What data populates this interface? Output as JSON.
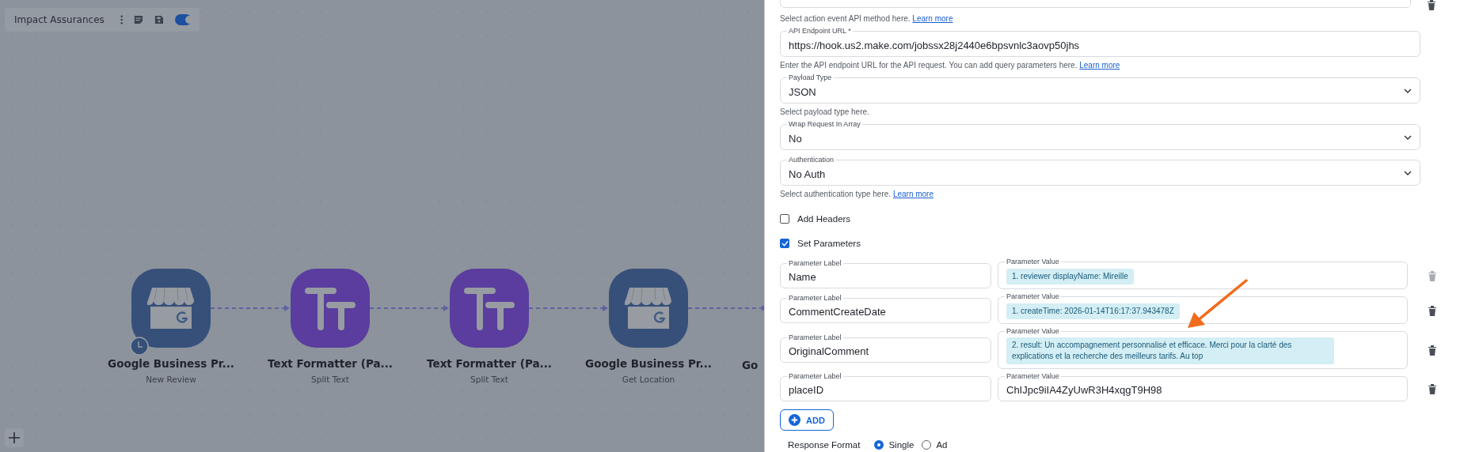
{
  "canvas": {
    "scenario_name": "Impact Assurances",
    "active": true,
    "nodes": [
      {
        "kind": "google",
        "title": "Google Business Pr...",
        "subtitle": "New Review",
        "trigger": true
      },
      {
        "kind": "text",
        "title": "Text Formatter (Pa...",
        "subtitle": "Split Text",
        "trigger": false
      },
      {
        "kind": "text",
        "title": "Text Formatter (Pa...",
        "subtitle": "Split Text",
        "trigger": false
      },
      {
        "kind": "google",
        "title": "Google Business Pr...",
        "subtitle": "Get Location",
        "trigger": false
      }
    ],
    "cut_node_title": "Go"
  },
  "panel": {
    "method_helper": {
      "text": "Select action event API method here.",
      "link": "Learn more"
    },
    "fields": [
      {
        "kind": "text",
        "label": "API Endpoint URL *",
        "value": "https://hook.us2.make.com/jobssx28j2440e6bpsvnlc3aovp50jhs",
        "helper": "Enter the API endpoint URL for the API request. You can add query parameters here.",
        "link": "Learn more"
      },
      {
        "kind": "select",
        "label": "Payload Type",
        "value": "JSON",
        "helper": "Select payload type here."
      },
      {
        "kind": "select",
        "label": "Wrap Request In Array",
        "value": "No"
      },
      {
        "kind": "select",
        "label": "Authentication",
        "value": "No Auth",
        "helper": "Select authentication type here.",
        "link": "Learn more"
      }
    ],
    "checkboxes": [
      {
        "label": "Add Headers",
        "checked": false
      },
      {
        "label": "Set Parameters",
        "checked": true
      }
    ],
    "parameters": [
      {
        "label_caption": "Parameter Label",
        "label": "Name",
        "value_caption": "Parameter Value",
        "value": "1. reviewer displayName: Mireille",
        "kind": "token",
        "disabled": true
      },
      {
        "label_caption": "Parameter Label",
        "label": "CommentCreateDate",
        "value_caption": "Parameter Value",
        "value": "1. createTime: 2026-01-14T16:17:37.943478Z",
        "kind": "token",
        "disabled": false
      },
      {
        "label_caption": "Parameter Label",
        "label": "OriginalComment",
        "value_caption": "Parameter Value",
        "value": "2. result: Un accompagnement personnalisé et efficace. Merci pour la clarté des explications et la recherche des meilleurs tarifs. Au top",
        "kind": "token",
        "disabled": false
      },
      {
        "label_caption": "Parameter Label",
        "label": "placeID",
        "value_caption": "Parameter Value",
        "value": "ChIJpc9iIA4ZyUwR3H4xqgT9H98",
        "kind": "plain",
        "disabled": false
      }
    ],
    "add_button": "ADD",
    "response_format": {
      "label": "Response Format",
      "options": [
        {
          "label": "Single",
          "selected": true
        },
        {
          "label": "Ad",
          "selected": false
        }
      ]
    }
  }
}
